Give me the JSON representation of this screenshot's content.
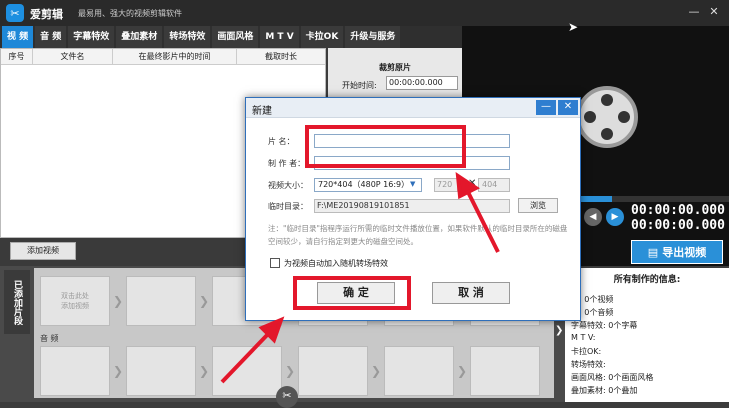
{
  "app": {
    "name": "爱剪辑",
    "slogan": "最易用、强大的视频剪辑软件",
    "minimize_glyph": "—",
    "close_glyph": "✕"
  },
  "tabs": [
    {
      "label": "视 频",
      "active": true
    },
    {
      "label": "音 频"
    },
    {
      "label": "字幕特效"
    },
    {
      "label": "叠加素材"
    },
    {
      "label": "转场特效"
    },
    {
      "label": "画面风格"
    },
    {
      "label": "M T V"
    },
    {
      "label": "卡拉OK"
    },
    {
      "label": "升级与服务"
    }
  ],
  "list": {
    "columns": [
      "序号",
      "文件名",
      "在最终影片中的时间",
      "截取时长"
    ]
  },
  "crop": {
    "title": "裁剪原片",
    "start_label": "开始时间:",
    "start_value": "00:00:00.000"
  },
  "player": {
    "timecode_current": "00:00:00.000",
    "timecode_total": "00:00:00.000",
    "export_label": "导出视频",
    "progress": 0.56
  },
  "add_video": {
    "label": "添加视频"
  },
  "timeline": {
    "side_tab": "已添加片段",
    "slot_hint": "双击此处\n添加视频",
    "audio_label": "音 频"
  },
  "info": {
    "title": "所有制作的信息:",
    "rows": [
      "频:    0个视频",
      "频:    0个音频",
      "字幕特效:  0个字幕",
      "M T V:",
      "卡拉OK:",
      "转场特效:",
      "画面风格:  0个画面风格",
      "叠加素材:  0个叠加"
    ]
  },
  "dialog": {
    "title": "新建",
    "minimize_glyph": "—",
    "close_glyph": "✕",
    "name_label": "片    名：",
    "name_value": "",
    "author_label": "制 作 者：",
    "author_value": "",
    "size_label": "视频大小：",
    "size_value": "720*404（480P 16:9）",
    "width_value": "720",
    "times_glyph": "✕",
    "height_value": "404",
    "tempdir_label": "临时目录：",
    "tempdir_value": "F:\\ME20190819101851",
    "browse_label": "浏览",
    "note": "注：\"临时目录\"指程序运行所需的临时文件播放位置，如果软件默认的临时目录所在的磁盘空间较少，请自行指定到更大的磁盘空间处。",
    "auto_transition_label": "为视频自动加入随机转场特效",
    "ok_label": "确 定",
    "cancel_label": "取 消"
  },
  "colors": {
    "accent": "#1e88d8",
    "annotation_red": "#e3172b"
  }
}
